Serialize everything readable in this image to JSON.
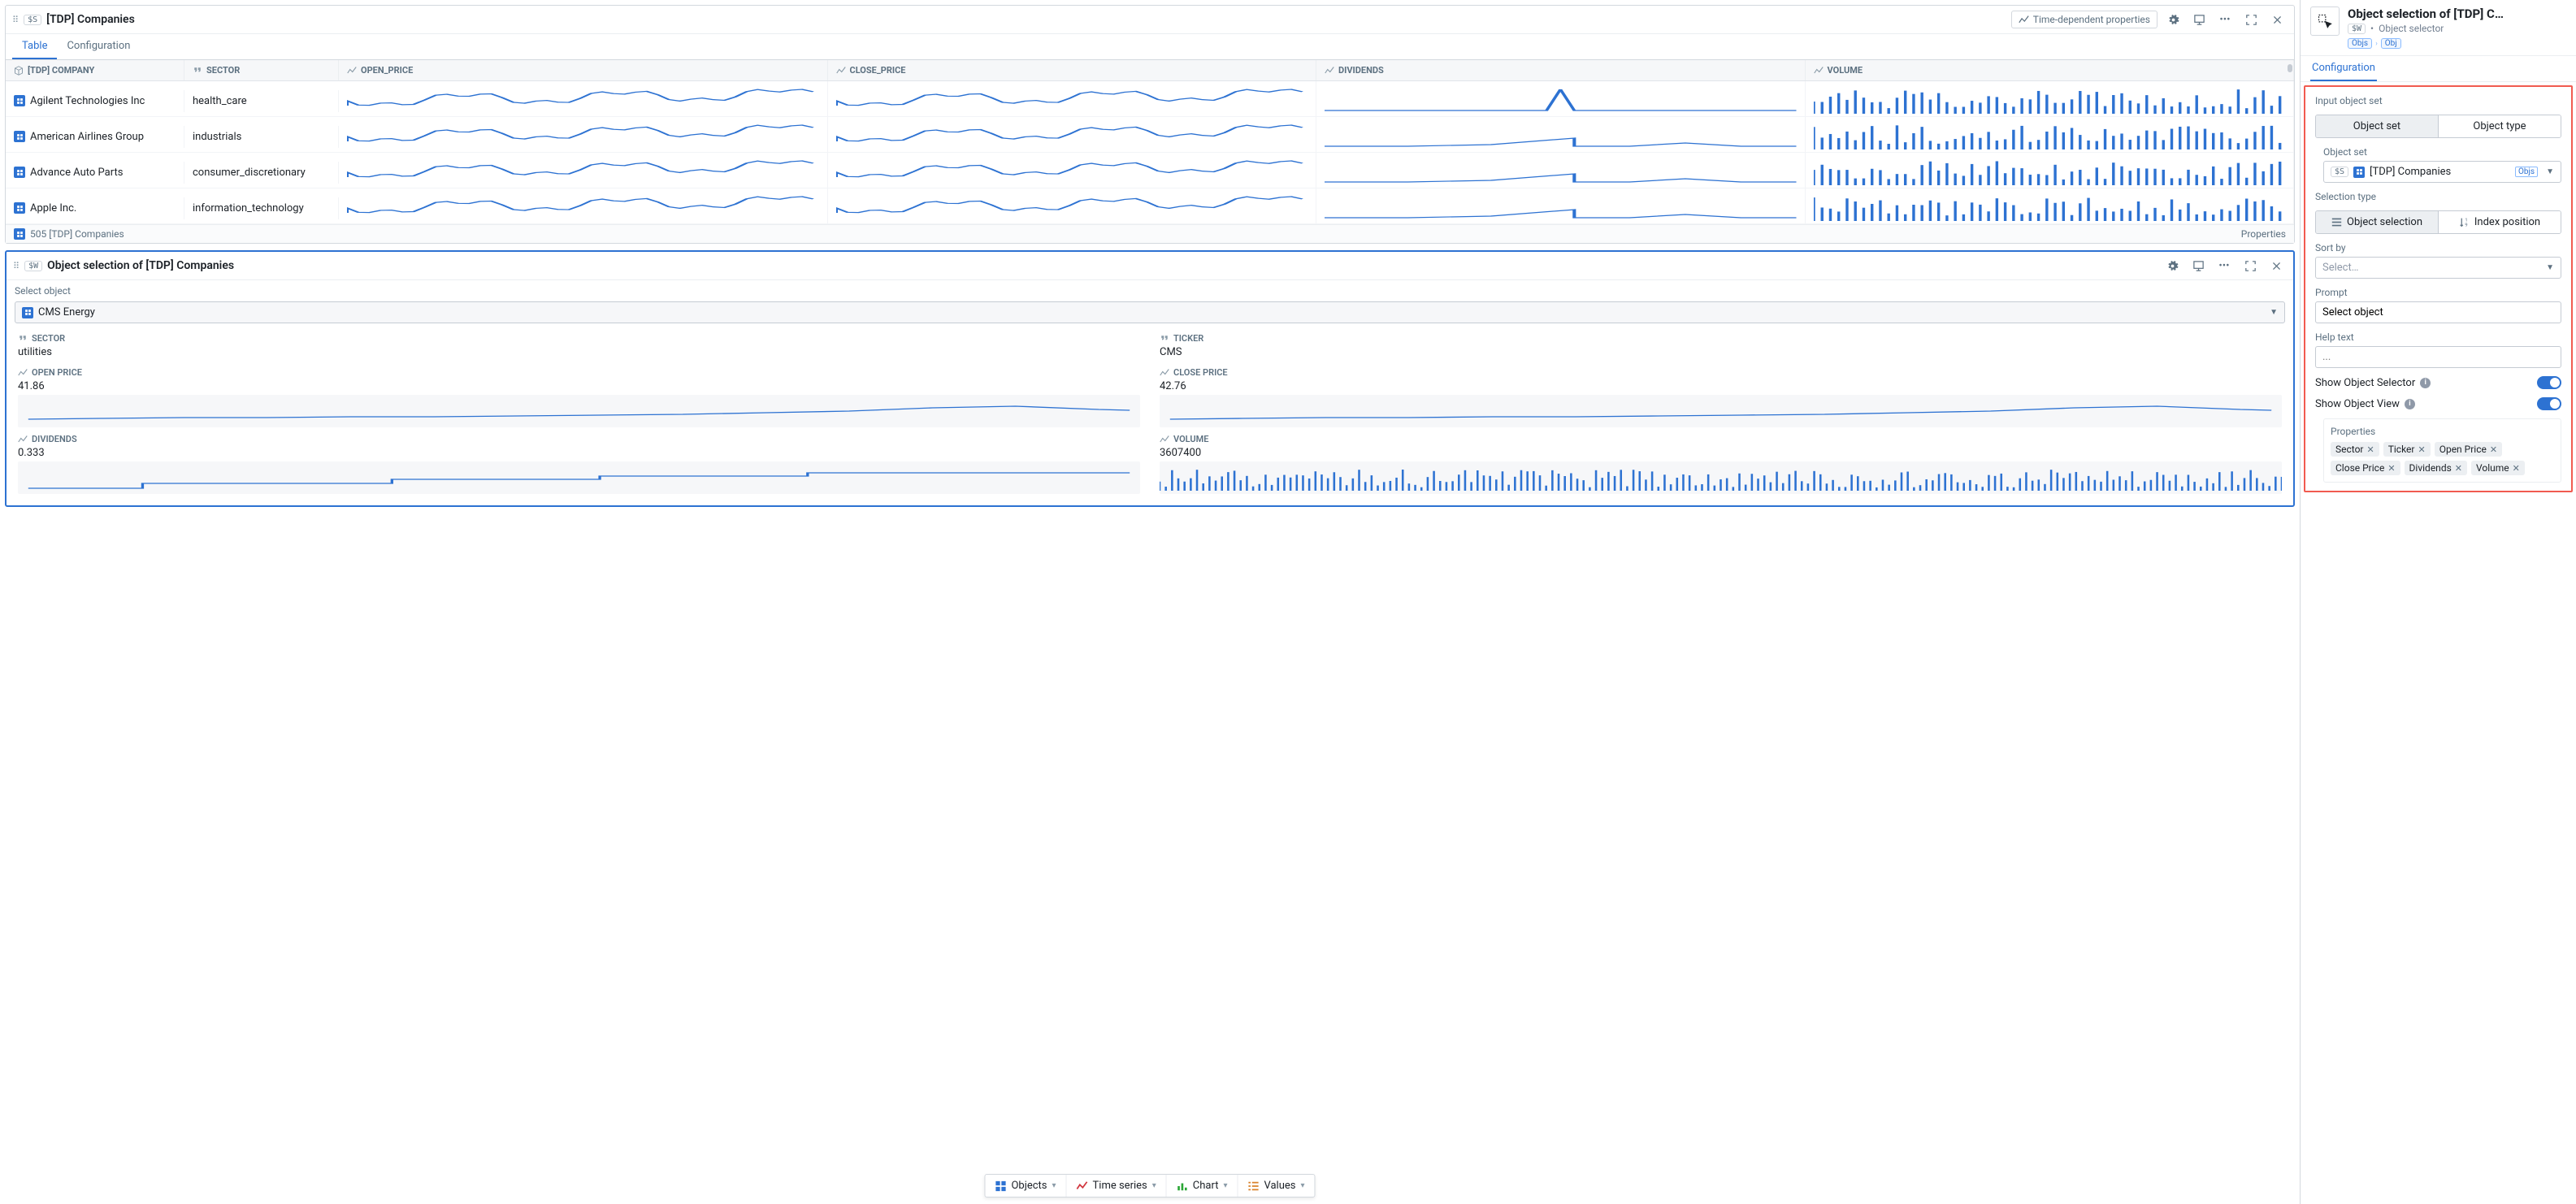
{
  "panels": {
    "companies": {
      "var": "$S",
      "title": "[TDP] Companies",
      "header_btn": "Time-dependent properties",
      "tabs": {
        "table": "Table",
        "config": "Configuration"
      },
      "columns": {
        "company": "[TDP] COMPANY",
        "sector": "SECTOR",
        "open": "OPEN_PRICE",
        "close": "CLOSE_PRICE",
        "dividends": "DIVIDENDS",
        "volume": "VOLUME"
      },
      "rows": [
        {
          "name": "Agilent Technologies Inc",
          "sector": "health_care"
        },
        {
          "name": "American Airlines Group",
          "sector": "industrials"
        },
        {
          "name": "Advance Auto Parts",
          "sector": "consumer_discretionary"
        },
        {
          "name": "Apple Inc.",
          "sector": "information_technology"
        }
      ],
      "footer_count": "505 [TDP] Companies",
      "footer_link": "Properties"
    },
    "selection": {
      "var": "$W",
      "title": "Object selection of [TDP] Companies",
      "prompt": "Select object",
      "selected": "CMS Energy",
      "details": {
        "sector": {
          "label": "SECTOR",
          "value": "utilities"
        },
        "ticker": {
          "label": "TICKER",
          "value": "CMS"
        },
        "open": {
          "label": "OPEN PRICE",
          "value": "41.86"
        },
        "close": {
          "label": "CLOSE PRICE",
          "value": "42.76"
        },
        "dividends": {
          "label": "DIVIDENDS",
          "value": "0.333"
        },
        "volume": {
          "label": "VOLUME",
          "value": "3607400"
        }
      }
    }
  },
  "bottom_bar": {
    "objects": "Objects",
    "timeseries": "Time series",
    "chart": "Chart",
    "values": "Values"
  },
  "sidebar": {
    "title": "Object selection of [TDP] C…",
    "var": "$W",
    "subtitle": "Object selector",
    "crumbs": [
      "Objs",
      "Obj"
    ],
    "tab": "Configuration",
    "sections": {
      "input_object_set": "Input object set",
      "object_set_tab": "Object set",
      "object_type_tab": "Object type",
      "object_set_label": "Object set",
      "object_set_value": "[TDP] Companies",
      "object_set_var": "$S",
      "objs_tag": "Objs",
      "selection_type": "Selection type",
      "object_selection": "Object selection",
      "index_position": "Index position",
      "sort_by": "Sort by",
      "sort_placeholder": "Select…",
      "prompt_label": "Prompt",
      "prompt_value": "Select object",
      "help_text": "Help text",
      "help_placeholder": "...",
      "show_selector": "Show Object Selector",
      "show_view": "Show Object View",
      "properties_label": "Properties",
      "properties": [
        "Sector",
        "Ticker",
        "Open Price",
        "Close Price",
        "Dividends",
        "Volume"
      ]
    }
  }
}
